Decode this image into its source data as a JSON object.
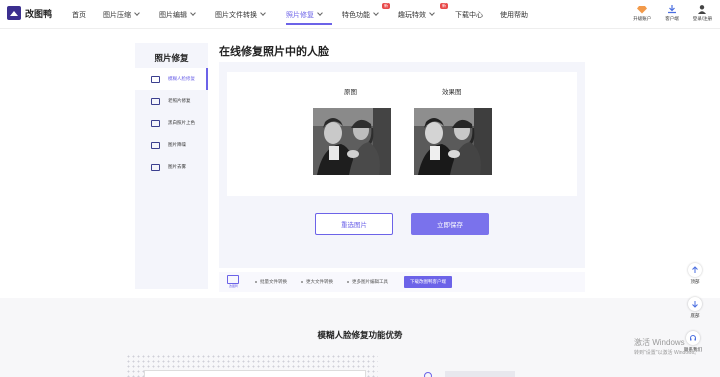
{
  "app": {
    "name": "改图鸭"
  },
  "nav": {
    "items": [
      {
        "label": "首页"
      },
      {
        "label": "图片压缩"
      },
      {
        "label": "图片编辑"
      },
      {
        "label": "图片文件转换"
      },
      {
        "label": "照片修复"
      },
      {
        "label": "特色功能"
      },
      {
        "label": "趣玩特效"
      },
      {
        "label": "下载中心"
      },
      {
        "label": "使用帮助"
      }
    ],
    "badge_new": "新",
    "upgrade": "升级账户",
    "client": "客户端",
    "login": "登录/注册"
  },
  "sidebar": {
    "title": "照片修复",
    "items": [
      {
        "label": "模糊人脸修复"
      },
      {
        "label": "老照片修复"
      },
      {
        "label": "黑白照片上色"
      },
      {
        "label": "图片降噪"
      },
      {
        "label": "图片去雾"
      }
    ]
  },
  "main": {
    "title": "在线修复照片中的人脸",
    "original_label": "原图",
    "result_label": "效果图",
    "reselect_button": "重选图片",
    "save_button": "立即保存"
  },
  "promo": {
    "logo_text": "改图鸭",
    "features": [
      "批量文件转换",
      "更大文件转换",
      "更多图片编辑工具"
    ],
    "download_button": "下载改图鸭客户端"
  },
  "section": {
    "title": "模糊人脸修复功能优势"
  },
  "float_tools": {
    "top": "顶部",
    "middle": "底部",
    "contact": "联系我们"
  },
  "watermark": {
    "line1": "激活 Windows",
    "line2": "转到\"设置\"以激活 Windows。"
  },
  "colors": {
    "accent": "#6c63e8",
    "badge": "#e84a4a"
  }
}
